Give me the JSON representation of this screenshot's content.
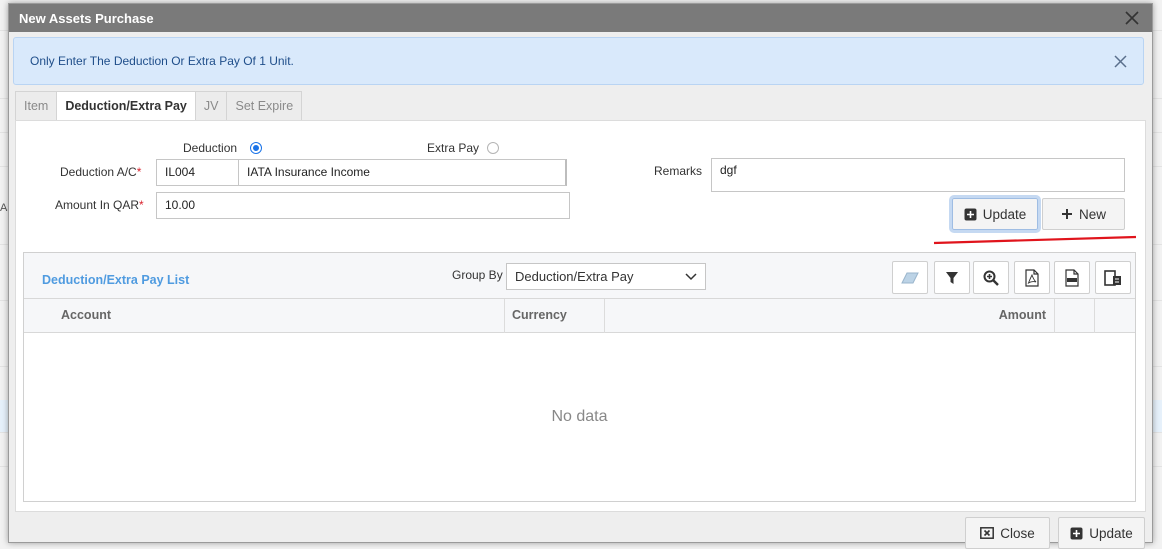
{
  "background": {
    "side_text": "As"
  },
  "dialog": {
    "title": "New Assets Purchase",
    "alert_text": "Only Enter The Deduction Or Extra Pay Of 1 Unit.",
    "tabs": [
      {
        "label": "Item",
        "active": false
      },
      {
        "label": "Deduction/Extra Pay",
        "active": true
      },
      {
        "label": "JV",
        "active": false
      },
      {
        "label": "Set Expire",
        "active": false
      }
    ]
  },
  "form": {
    "type_options": [
      {
        "label": "Deduction",
        "checked": true
      },
      {
        "label": "Extra Pay",
        "checked": false
      }
    ],
    "deduction_ac_label": "Deduction A/C",
    "required_mark": "*",
    "account_code": "IL004",
    "account_name": "IATA Insurance Income",
    "amount_label": "Amount In QAR",
    "amount_value": "10.00",
    "remarks_label": "Remarks",
    "remarks_value": "dgf",
    "update_label": "Update",
    "new_label": "New"
  },
  "list": {
    "title": "Deduction/Extra Pay List",
    "group_by_label": "Group By",
    "group_by_value": "Deduction/Extra Pay",
    "columns": [
      "Account",
      "Currency",
      "Amount"
    ],
    "empty_text": "No data",
    "toolbar_icons": [
      "eraser-icon",
      "filter-icon",
      "zoom-in-icon",
      "pdf-icon",
      "xlsx-icon",
      "column-chooser-icon"
    ]
  },
  "footer": {
    "close_label": "Close",
    "update_label": "Update"
  },
  "colors": {
    "accent": "#1a73e8",
    "title_bar": "#7a7a7a",
    "alert_bg": "#d9e9fb",
    "list_title": "#4f9be0",
    "annotation": "#e0141c"
  }
}
